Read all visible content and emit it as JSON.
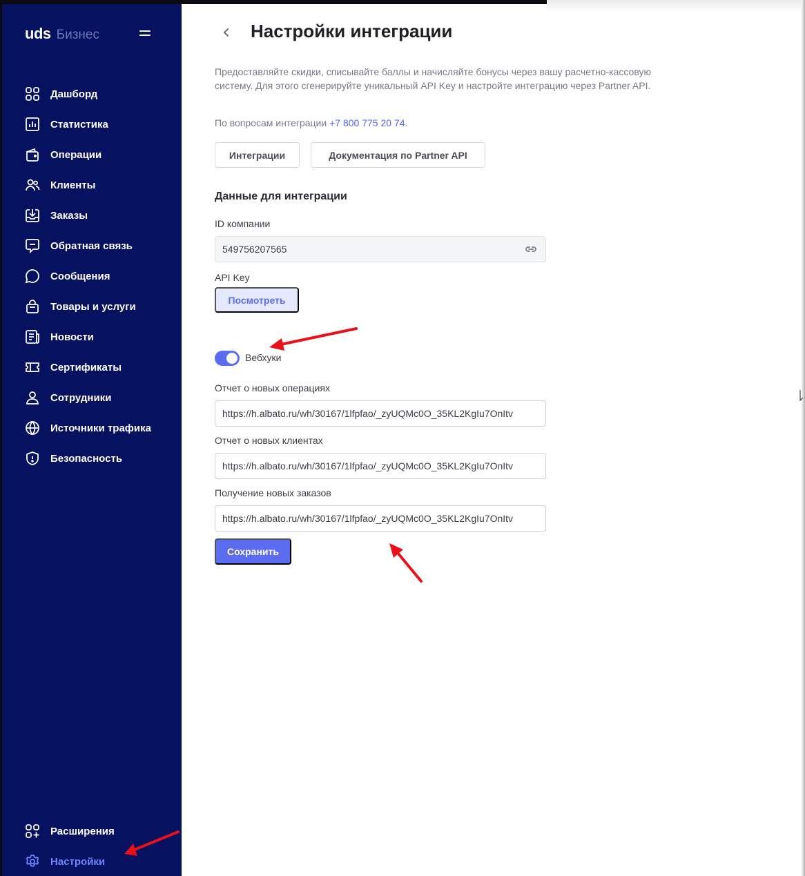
{
  "brand": {
    "name": "uds",
    "suffix": "Бизнес"
  },
  "sidebar": {
    "items": [
      {
        "label": "Дашборд",
        "icon": "dashboard-icon"
      },
      {
        "label": "Статистика",
        "icon": "bar-chart-icon"
      },
      {
        "label": "Операции",
        "icon": "wallet-icon"
      },
      {
        "label": "Клиенты",
        "icon": "users-icon"
      },
      {
        "label": "Заказы",
        "icon": "download-box-icon"
      },
      {
        "label": "Обратная связь",
        "icon": "chat-square-icon"
      },
      {
        "label": "Сообщения",
        "icon": "chat-bubble-icon"
      },
      {
        "label": "Товары и услуги",
        "icon": "bag-icon"
      },
      {
        "label": "Новости",
        "icon": "news-icon"
      },
      {
        "label": "Сертификаты",
        "icon": "ticket-icon"
      },
      {
        "label": "Сотрудники",
        "icon": "person-icon"
      },
      {
        "label": "Источники трафика",
        "icon": "globe-icon"
      },
      {
        "label": "Безопасность",
        "icon": "shield-icon"
      }
    ],
    "bottom": [
      {
        "label": "Расширения",
        "icon": "extensions-icon"
      },
      {
        "label": "Настройки",
        "icon": "gear-icon",
        "active": true
      }
    ]
  },
  "page": {
    "title": "Настройки интеграции",
    "description": "Предоставляйте скидки, списывайте баллы и начисляйте бонусы через вашу расчетно-кассовую систему. Для этого сгенерируйте уникальный API Key и настройте интеграцию через Partner API.",
    "support_prefix": "По вопросам интеграции",
    "support_phone": "+7 800 775 20 74",
    "support_suffix": ".",
    "buttons": {
      "integrations": "Интеграции",
      "docs": "Документация по Partner API"
    }
  },
  "integration": {
    "section_title": "Данные для интеграции",
    "company_id_label": "ID компании",
    "company_id_value": "549756207565",
    "api_key_label": "API Key",
    "view_button": "Посмотреть"
  },
  "webhooks": {
    "toggle_label": "Вебхуки",
    "enabled": true,
    "fields": [
      {
        "label": "Отчет о новых операциях",
        "value": "https://h.albato.ru/wh/30167/1lfpfao/_zyUQMc0O_35KL2KgIu7OnItv"
      },
      {
        "label": "Отчет о новых клиентах",
        "value": "https://h.albato.ru/wh/30167/1lfpfao/_zyUQMc0O_35KL2KgIu7OnItv"
      },
      {
        "label": "Получение новых заказов",
        "value": "https://h.albato.ru/wh/30167/1lfpfao/_zyUQMc0O_35KL2KgIu7OnItv"
      }
    ],
    "save_button": "Сохранить"
  },
  "colors": {
    "sidebar_bg": "#06115f",
    "accent": "#5b6cf0",
    "annotation_arrow": "#e8101a"
  }
}
